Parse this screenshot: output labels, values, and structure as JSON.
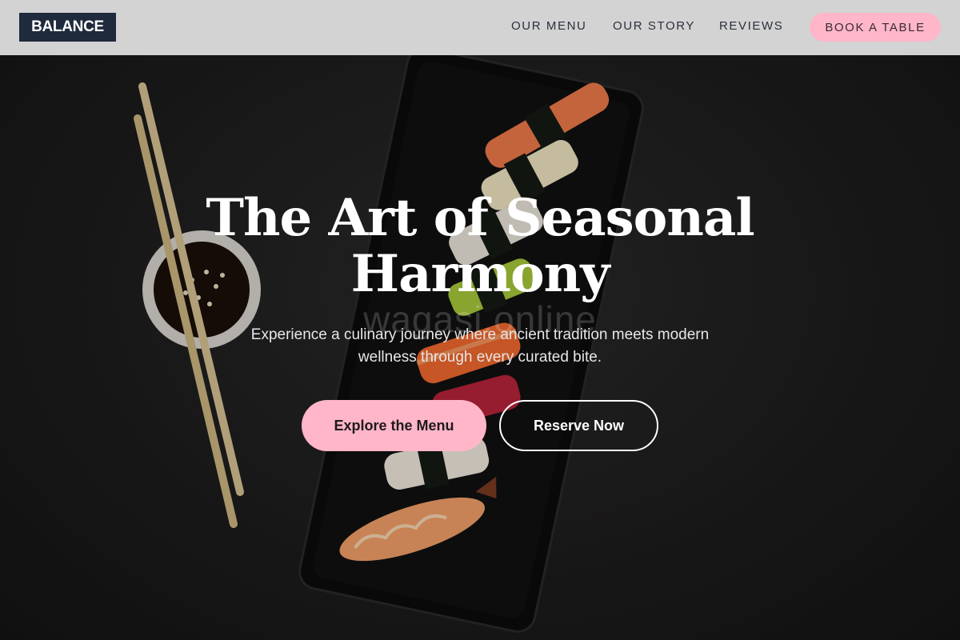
{
  "header": {
    "logo_text": "BALANCE",
    "nav": [
      {
        "label": "OUR MENU"
      },
      {
        "label": "OUR STORY"
      },
      {
        "label": "REVIEWS"
      }
    ],
    "book_label": "BOOK A TABLE"
  },
  "hero": {
    "headline_line1": "The Art of Seasonal",
    "headline_line2": "Harmony",
    "watermark": "wagasi.online",
    "subtext_line1": "Experience a culinary journey where ancient tradition meets modern",
    "subtext_line2": "wellness through every curated bite.",
    "primary_cta": "Explore the Menu",
    "secondary_cta": "Reserve Now",
    "image": "sushi-platter-with-chopsticks-and-soy-sauce"
  },
  "colors": {
    "header_bg": "#d3d3d4",
    "logo_bg": "#1f2a3c",
    "accent_pink": "#ffb6c9",
    "hero_dark": "#1c1b1b",
    "text_light": "#ffffff"
  }
}
